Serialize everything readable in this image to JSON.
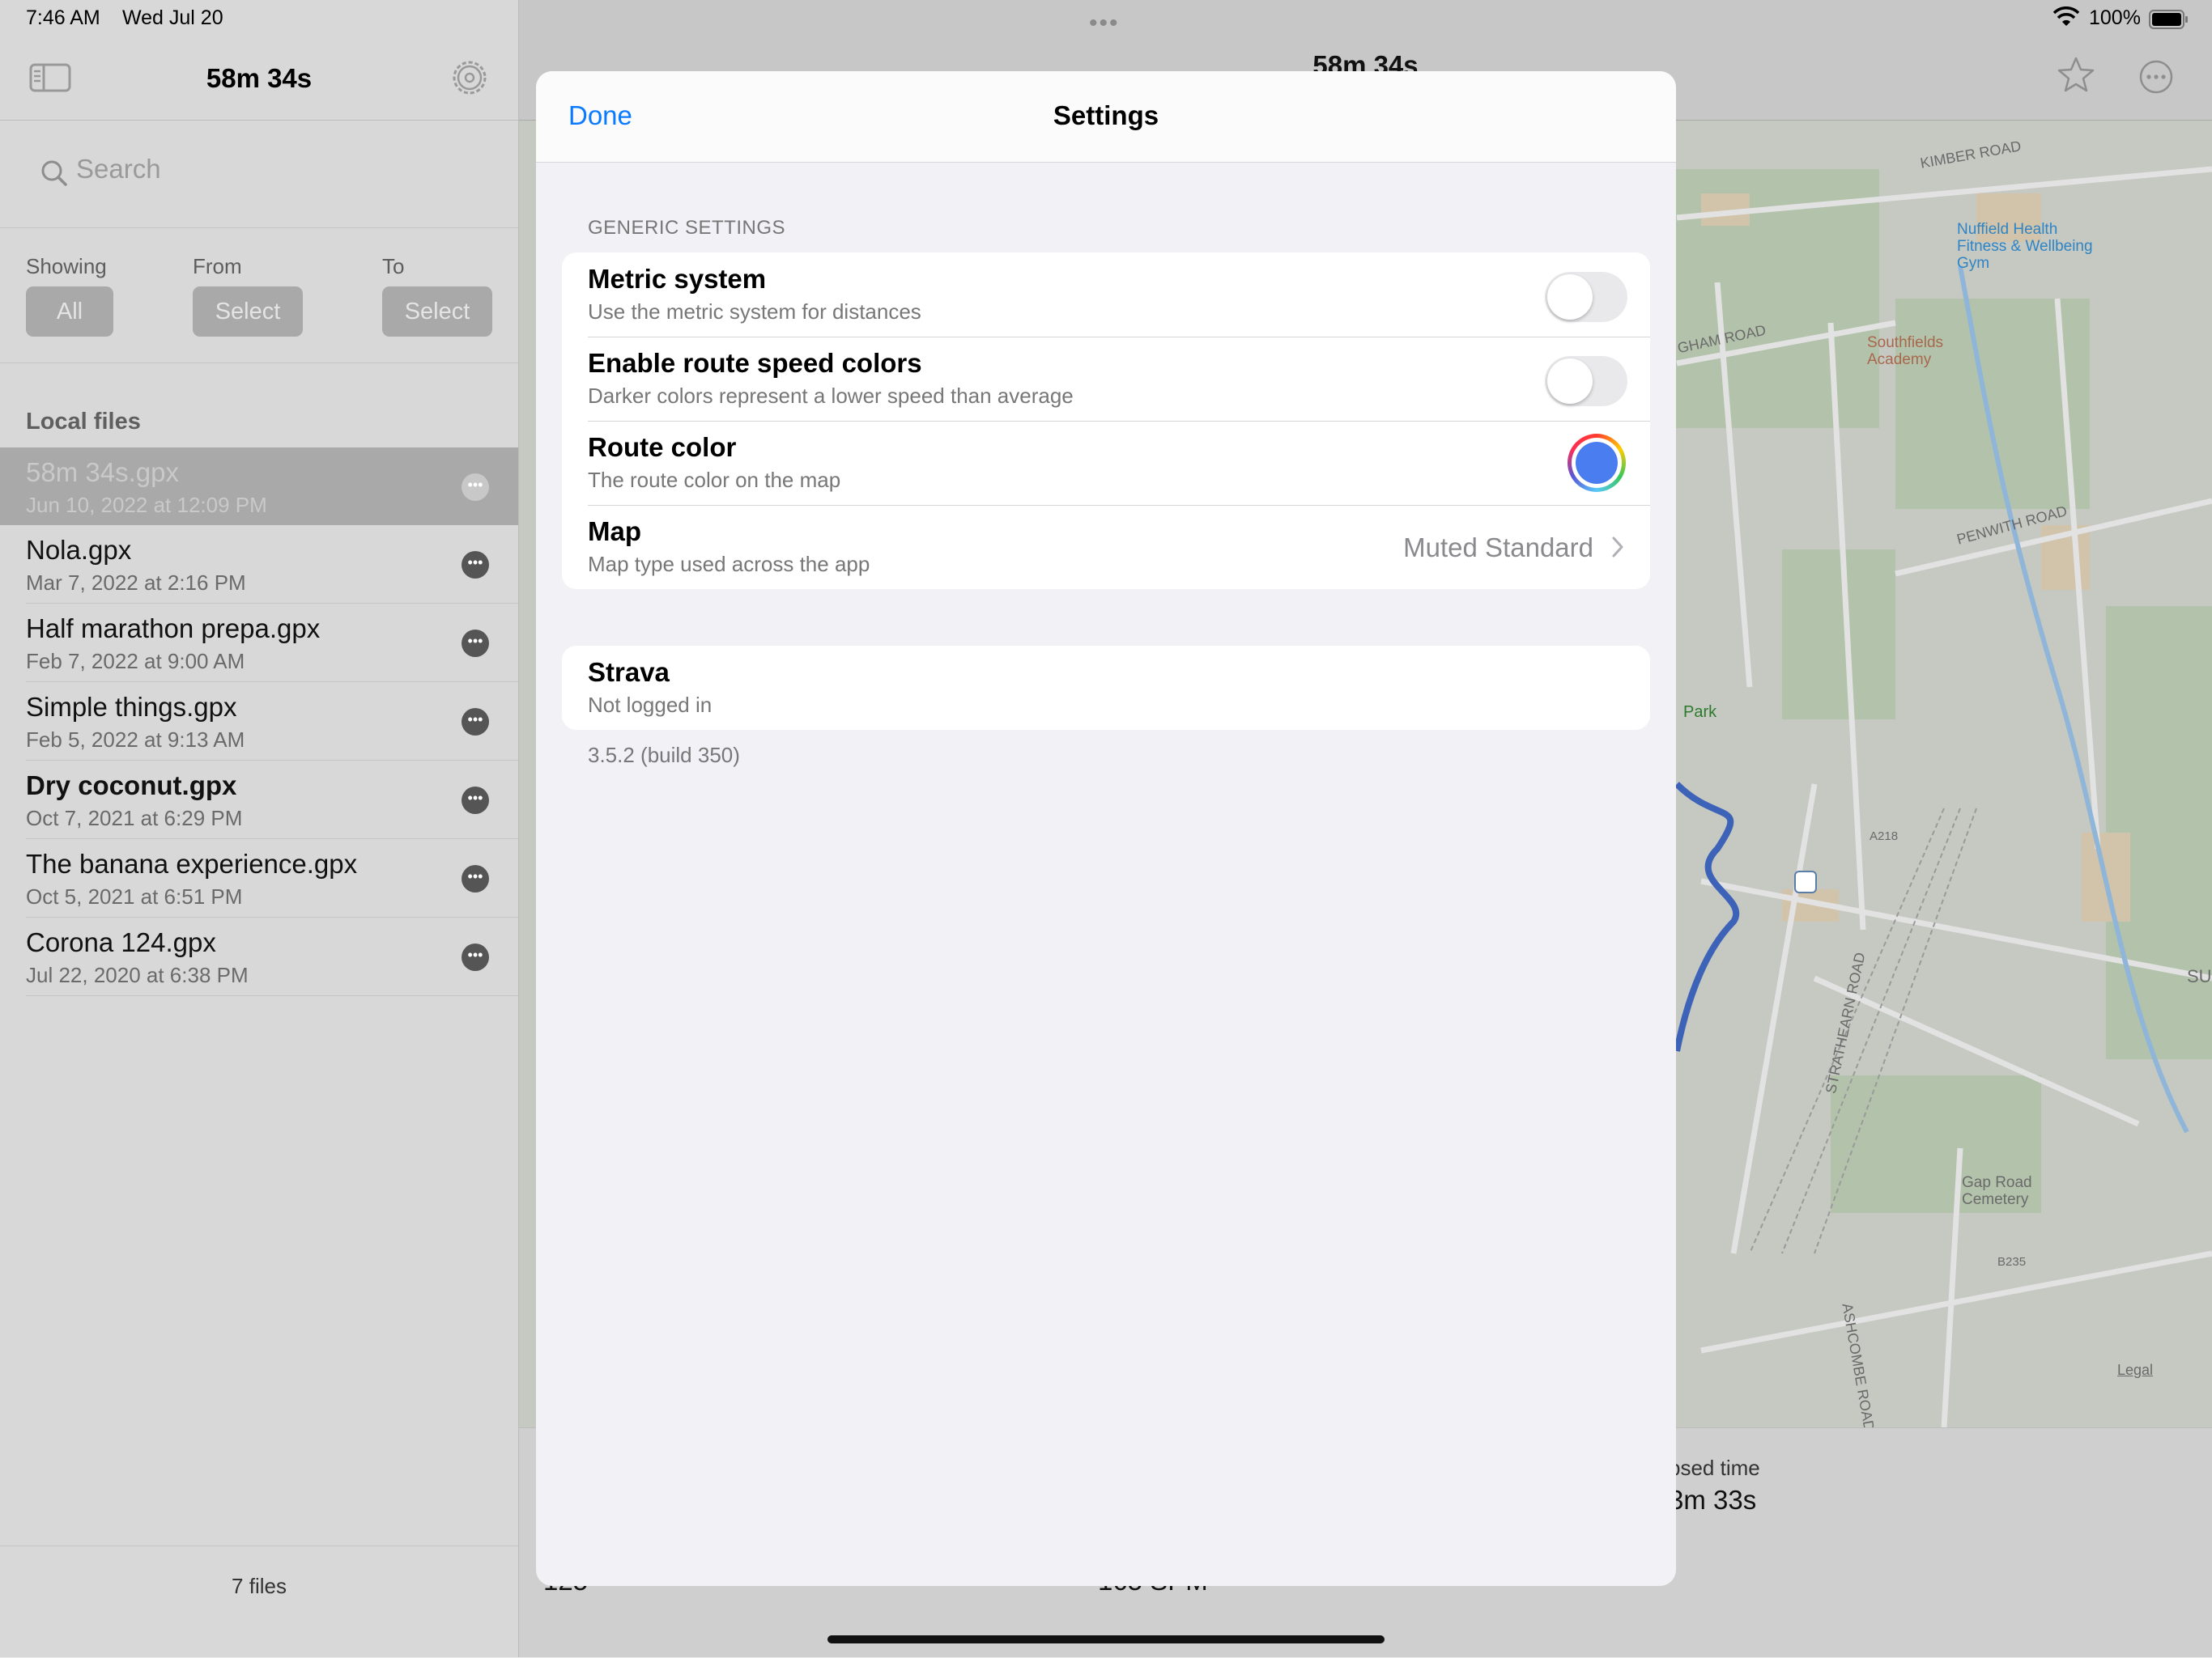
{
  "status_bar": {
    "time": "7:46 AM",
    "date": "Wed Jul 20",
    "battery": "100%"
  },
  "sidebar": {
    "title": "58m 34s",
    "search_placeholder": "Search",
    "filters": {
      "showing_label": "Showing",
      "showing_value": "All",
      "from_label": "From",
      "from_value": "Select",
      "to_label": "To",
      "to_value": "Select"
    },
    "section_title": "Local files",
    "files": [
      {
        "name": "58m 34s.gpx",
        "date": "Jun 10, 2022 at 12:09 PM",
        "selected": true,
        "bold": false
      },
      {
        "name": "Nola.gpx",
        "date": "Mar 7, 2022 at 2:16 PM",
        "selected": false,
        "bold": false
      },
      {
        "name": "Half marathon prepa.gpx",
        "date": "Feb 7, 2022 at 9:00 AM",
        "selected": false,
        "bold": false
      },
      {
        "name": "Simple things.gpx",
        "date": "Feb 5, 2022 at 9:13 AM",
        "selected": false,
        "bold": false
      },
      {
        "name": "Dry coconut.gpx",
        "date": "Oct 7, 2021 at 6:29 PM",
        "selected": false,
        "bold": true
      },
      {
        "name": "The banana experience.gpx",
        "date": "Oct 5, 2021 at 6:51 PM",
        "selected": false,
        "bold": false
      },
      {
        "name": "Corona 124.gpx",
        "date": "Jul 22, 2020 at 6:38 PM",
        "selected": false,
        "bold": false
      }
    ],
    "footer": "7 files"
  },
  "main": {
    "title": "58m 34s",
    "map_labels": {
      "kimber_road": "KIMBER ROAD",
      "nuffield": "Nuffield Health Fitness & Wellbeing Gym",
      "southfields": "Southfields Academy",
      "gham_road": "GHAM ROAD",
      "penwith_road": "PENWITH ROAD",
      "park": "Park",
      "a218": "A218",
      "strathearn_road": "STRATHEARN ROAD",
      "gap_road": "Gap Road Cemetery",
      "b235": "B235",
      "ashcombe_road": "ASHCOMBE ROAD",
      "sum": "SUM",
      "legal": "Legal"
    },
    "stats": {
      "elapsed_label": "psed time",
      "elapsed_value": "3m 33s",
      "left_partial": "125",
      "center_partial": "165 SPM"
    }
  },
  "settings": {
    "done": "Done",
    "title": "Settings",
    "group_header": "GENERIC SETTINGS",
    "rows": {
      "metric": {
        "title": "Metric system",
        "subtitle": "Use the metric system for distances",
        "enabled": false
      },
      "speed_colors": {
        "title": "Enable route speed colors",
        "subtitle": "Darker colors represent a lower speed than average",
        "enabled": false
      },
      "route_color": {
        "title": "Route color",
        "subtitle": "The route color on the map",
        "color": "#4a7df0"
      },
      "map": {
        "title": "Map",
        "subtitle": "Map type used across the app",
        "value": "Muted Standard"
      }
    },
    "strava": {
      "title": "Strava",
      "subtitle": "Not logged in"
    },
    "version": "3.5.2 (build 350)"
  },
  "colors": {
    "accent": "#0a7aff",
    "route": "#4a7df0"
  }
}
